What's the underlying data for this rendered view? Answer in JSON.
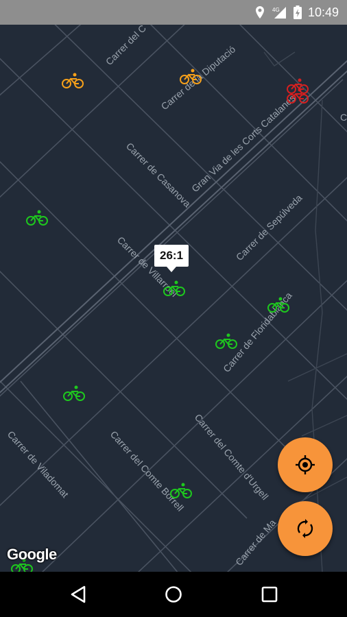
{
  "status_bar": {
    "time": "10:49",
    "icons": [
      "location-icon",
      "signal-4g-icon",
      "battery-charging-icon"
    ]
  },
  "map": {
    "street_labels": [
      "Carrer del C",
      "Carrer de la Diputació",
      "Gran Via de les Corts Catalanes",
      "Carrer de Casanova",
      "Carrer de Sepúlveda",
      "Carrer de Villarroel",
      "Carrer de Floridablanca",
      "Carrer del Comte d'Urgell",
      "Carrer del Comte Borrell",
      "Carrer de Viladomat",
      "Carrer de Ma",
      "C"
    ],
    "selected_station_label": "26:1",
    "attribution": "Google",
    "colors": {
      "background": "#222b38",
      "bike_available": "#1ec81e",
      "bike_low": "#f7a11a",
      "bike_empty": "#d62020",
      "fab": "#f7943a"
    }
  },
  "actions": {
    "my_location_icon": "my-location-icon",
    "refresh_icon": "refresh-icon"
  },
  "nav": {
    "back_icon": "back-icon",
    "home_icon": "home-icon",
    "recents_icon": "recents-icon"
  }
}
